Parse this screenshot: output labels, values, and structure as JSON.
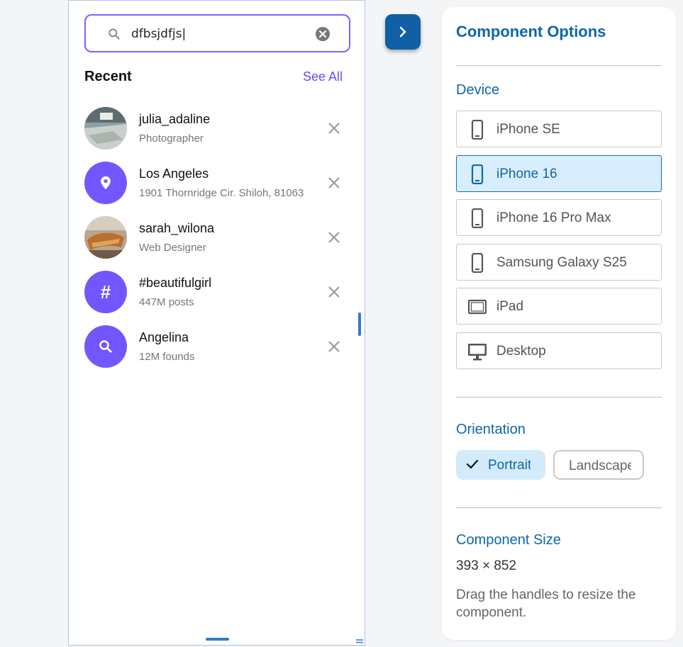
{
  "search": {
    "value": "dfbsjdfjs|"
  },
  "recent": {
    "title": "Recent",
    "see_all_label": "See All",
    "items": [
      {
        "name": "julia_adaline",
        "subtitle": "Photographer",
        "avatar": "photo"
      },
      {
        "name": "Los Angeles",
        "subtitle": "1901 Thornridge Cir. Shiloh, 81063",
        "avatar": "location-pin-icon"
      },
      {
        "name": "sarah_wilona",
        "subtitle": "Web Designer",
        "avatar": "photo"
      },
      {
        "name": "#beautifulgirl",
        "subtitle": "447M posts",
        "avatar": "hashtag-icon",
        "avatar_symbol": "#"
      },
      {
        "name": "Angelina",
        "subtitle": "12M founds",
        "avatar": "search-icon"
      }
    ]
  },
  "panel": {
    "title": "Component Options",
    "device": {
      "label": "Device",
      "options": [
        {
          "label": "iPhone SE",
          "icon": "phone-icon",
          "selected": false
        },
        {
          "label": "iPhone 16",
          "icon": "phone-icon",
          "selected": true
        },
        {
          "label": "iPhone 16 Pro Max",
          "icon": "phone-icon",
          "selected": false
        },
        {
          "label": "Samsung Galaxy S25",
          "icon": "phone-icon",
          "selected": false
        },
        {
          "label": "iPad",
          "icon": "tablet-icon",
          "selected": false
        },
        {
          "label": "Desktop",
          "icon": "desktop-icon",
          "selected": false
        }
      ]
    },
    "orientation": {
      "label": "Orientation",
      "options": [
        {
          "label": "Portrait",
          "selected": true
        },
        {
          "label": "Landscape",
          "selected": false
        }
      ]
    },
    "size": {
      "label": "Component Size",
      "value": "393 × 852",
      "help": "Drag the handles to resize the component."
    }
  },
  "colors": {
    "accent_purple": "#7356ff",
    "see_all": "#6a4cf5",
    "panel_blue": "#0e67a6",
    "toggle_blue": "#115fa4",
    "selected_bg": "#d9eefc"
  }
}
